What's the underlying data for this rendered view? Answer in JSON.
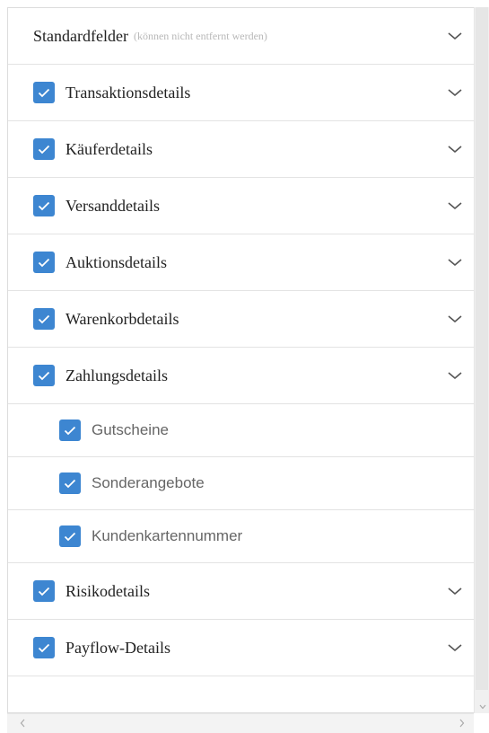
{
  "standard": {
    "label": "Standardfelder",
    "hint": "(können nicht entfernt werden)"
  },
  "sections": [
    {
      "label": "Transaktionsdetails",
      "checked": true
    },
    {
      "label": "Käuferdetails",
      "checked": true
    },
    {
      "label": "Versanddetails",
      "checked": true
    },
    {
      "label": "Auktionsdetails",
      "checked": true
    },
    {
      "label": "Warenkorbdetails",
      "checked": true
    },
    {
      "label": "Zahlungsdetails",
      "checked": true
    }
  ],
  "sub_items": [
    {
      "label": "Gutscheine",
      "checked": true
    },
    {
      "label": "Sonderangebote",
      "checked": true
    },
    {
      "label": "Kundenkartennummer",
      "checked": true
    }
  ],
  "sections_after": [
    {
      "label": "Risikodetails",
      "checked": true
    },
    {
      "label": "Payflow-Details",
      "checked": true
    }
  ],
  "icons": {
    "checkbox": "check-icon",
    "expand": "chevron-down-icon"
  },
  "colors": {
    "checkbox": "#3d86d1"
  }
}
